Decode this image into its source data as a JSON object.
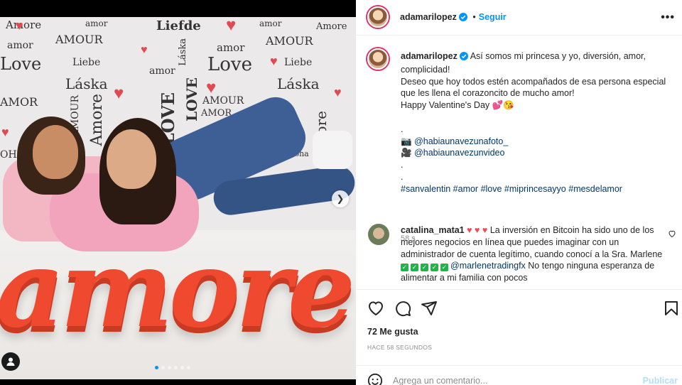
{
  "media": {
    "wall_words": [
      "Amore",
      "amor",
      "Liefde",
      "amor",
      "Amore",
      "AMOUR",
      "amor",
      "AMOUR",
      "amor",
      "Love",
      "Liebe",
      "Láska",
      "amor",
      "Love",
      "Liebe",
      "Láska",
      "Láska",
      "LOVE",
      "AMOR",
      "Amore",
      "AMOUR",
      "Amore",
      "AMOR",
      "Aloha",
      "OHA",
      "LOVE",
      "AMOUR"
    ],
    "sculpture_text": "amore",
    "carousel": {
      "count": 6,
      "active_index": 0
    }
  },
  "header": {
    "username": "adamarilopez",
    "separator": "•",
    "follow_label": "Seguir",
    "more_label": "•••"
  },
  "caption": {
    "username": "adamarilopez",
    "lines": [
      "Así somos mi princesa y yo, diversión, amor, complicidad!",
      "Deseo que hoy todos estén acompañados de esa persona especial que les llena el corazoncito de mucho amor!",
      "Happy Valentine's Day 💕😘",
      "",
      "."
    ],
    "credit_photo_icon": "📷",
    "credit_photo": "@habiaunavezunafoto_",
    "credit_video_icon": "🎥",
    "credit_video": "@habiaunavezunvideo",
    "dots": [
      ".",
      "."
    ],
    "hashtags": "#sanvalentin #amor #love #miprincesayyo #mesdelamor",
    "time": "58 s"
  },
  "comment": {
    "username": "catalina_mata1",
    "hearts": "♥ ♥ ♥",
    "text_a": "La inversión en Bitcoin ha sido uno de los mejores negocios en línea que puedes imaginar con un administrador de cuenta legítimo, cuando conocí a la Sra. Marlene",
    "checks": [
      "✓",
      "✓",
      "✓",
      "✓",
      "✓"
    ],
    "mention": "@marlenetradingfx",
    "text_b": "No tengo ninguna esperanza de alimentar a mi familia con pocos"
  },
  "actions": {
    "likes": "72 Me gusta",
    "ago": "HACE 58 SEGUNDOS"
  },
  "add_comment": {
    "placeholder": "Agrega un comentario...",
    "publish_label": "Publicar"
  },
  "colors": {
    "accent": "#0095f6",
    "link": "#00376b",
    "muted": "#8e8e8e",
    "heart_red": "#ed4956",
    "sculpture": "#ef4a2f"
  }
}
